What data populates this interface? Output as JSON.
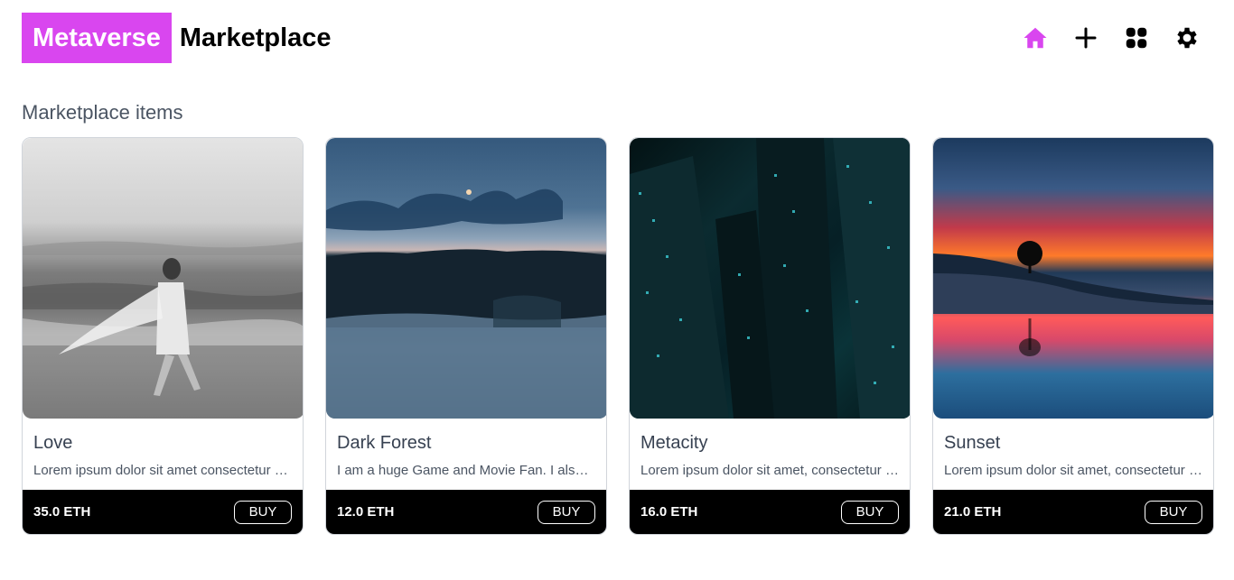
{
  "brand": {
    "highlight": "Metaverse",
    "rest": "Marketplace",
    "accent_color": "#d946ef"
  },
  "nav": {
    "icons": [
      "home-icon",
      "plus-icon",
      "grid-icon",
      "gear-icon"
    ]
  },
  "section": {
    "title": "Marketplace items"
  },
  "items": [
    {
      "title": "Love",
      "description": "Lorem ipsum dolor sit amet consectetur adipiscing elit",
      "price": "35.0 ETH",
      "buy_label": "BUY"
    },
    {
      "title": "Dark Forest",
      "description": "I am a huge Game and Movie Fan. I also love",
      "price": "12.0 ETH",
      "buy_label": "BUY"
    },
    {
      "title": "Metacity",
      "description": "Lorem ipsum dolor sit amet, consectetur adipiscing",
      "price": "16.0 ETH",
      "buy_label": "BUY"
    },
    {
      "title": "Sunset",
      "description": "Lorem ipsum dolor sit amet, consectetur adipiscing",
      "price": "21.0 ETH",
      "buy_label": "BUY"
    }
  ]
}
